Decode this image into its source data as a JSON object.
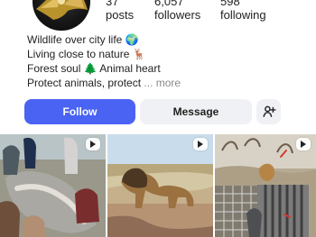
{
  "profile": {
    "stats": [
      {
        "count": "37",
        "label": "posts"
      },
      {
        "count": "6,057",
        "label": "followers"
      },
      {
        "count": "598",
        "label": "following"
      }
    ],
    "bio": [
      {
        "text": "Wildlife over city life 🌍"
      },
      {
        "text": "Living close to nature 🦌"
      },
      {
        "text": "Forest soul 🌲 Animal heart"
      },
      {
        "text": "Protect animals, protect",
        "more": "... more"
      }
    ]
  },
  "actions": {
    "follow_label": "Follow",
    "message_label": "Message"
  },
  "grid": {
    "items": [
      {
        "icon": "video-icon"
      },
      {
        "icon": "video-icon"
      },
      {
        "icon": "video-icon"
      }
    ]
  },
  "colors": {
    "accent": "#4a63f2",
    "button_bg": "#f0f1f4"
  }
}
